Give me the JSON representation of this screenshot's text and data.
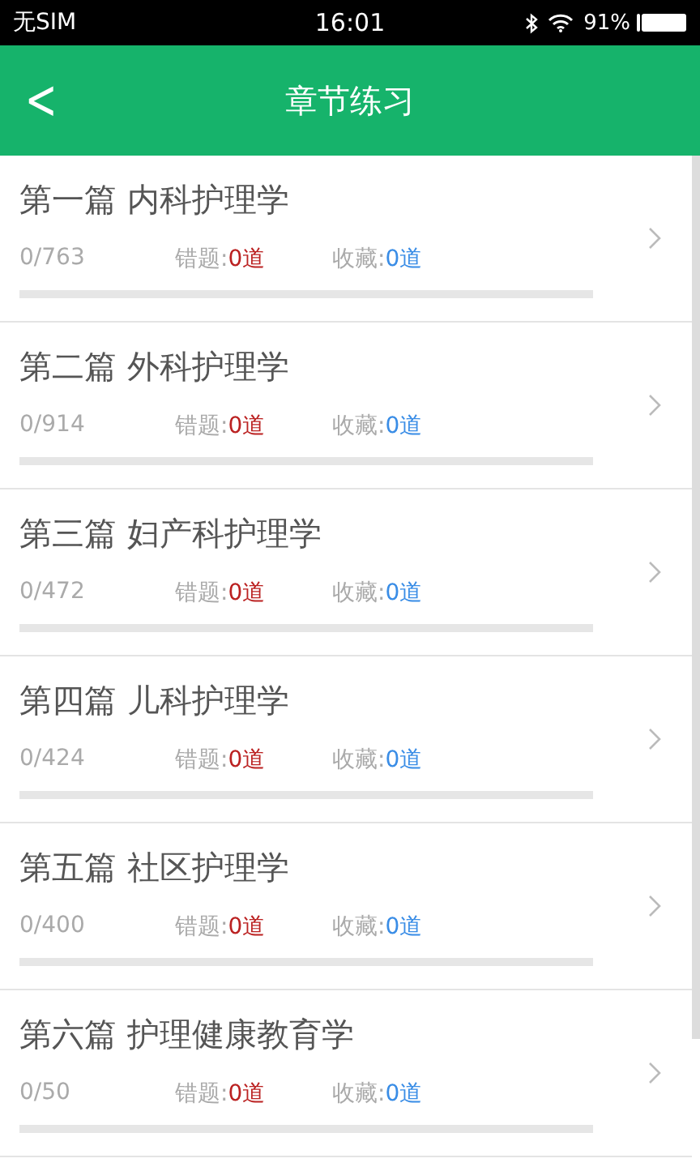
{
  "status_bar": {
    "carrier": "无SIM",
    "time": "16:01",
    "battery": "91%"
  },
  "nav": {
    "back": "<",
    "title": "章节练习"
  },
  "chapters": [
    {
      "title": "第一篇 内科护理学",
      "progress": "0/763",
      "wrong_label": "错题:",
      "wrong_count": "0道",
      "fav_label": "收藏:",
      "fav_count": "0道",
      "level": 0
    },
    {
      "title": "第二篇 外科护理学",
      "progress": "0/914",
      "wrong_label": "错题:",
      "wrong_count": "0道",
      "fav_label": "收藏:",
      "fav_count": "0道",
      "level": 0
    },
    {
      "title": "第三篇 妇产科护理学",
      "progress": "0/472",
      "wrong_label": "错题:",
      "wrong_count": "0道",
      "fav_label": "收藏:",
      "fav_count": "0道",
      "level": 0
    },
    {
      "title": "第四篇 儿科护理学",
      "progress": "0/424",
      "wrong_label": "错题:",
      "wrong_count": "0道",
      "fav_label": "收藏:",
      "fav_count": "0道",
      "level": 0
    },
    {
      "title": "第五篇 社区护理学",
      "progress": "0/400",
      "wrong_label": "错题:",
      "wrong_count": "0道",
      "fav_label": "收藏:",
      "fav_count": "0道",
      "level": 0
    },
    {
      "title": "第六篇 护理健康教育学",
      "progress": "0/50",
      "wrong_label": "错题:",
      "wrong_count": "0道",
      "fav_label": "收藏:",
      "fav_count": "0道",
      "level": 0
    }
  ]
}
